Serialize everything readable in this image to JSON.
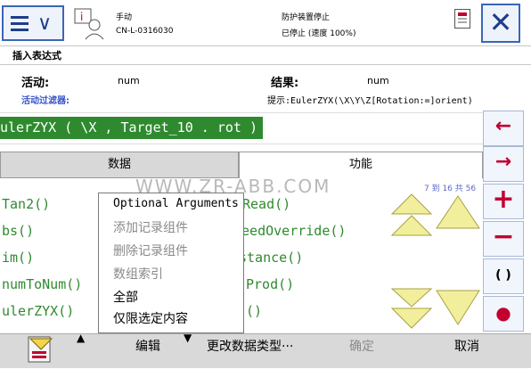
{
  "status": {
    "mode": "手动",
    "controller": "CN-L-0316030",
    "safety": "防护装置停止",
    "run_state": "已停止 (速度 100%)"
  },
  "dialog": {
    "title": "插入表达式",
    "active_label": "活动:",
    "active_value": "num",
    "result_label": "结果:",
    "result_value": "num",
    "filter_label": "活动过滤器:",
    "hint": "提示:EulerZYX(\\X\\Y\\Z[Rotation:=]orient)",
    "expression": "ulerZYX ( \\X , Target_10 . rot )"
  },
  "tabs": {
    "data": "数据",
    "functions": "功能"
  },
  "function_list": {
    "left": [
      "Tan2()",
      "bs()",
      "im()",
      "numToNum()",
      "ulerZYX()"
    ],
    "right": [
      "Read()",
      "peedOverride()",
      "stance()",
      "Prod()",
      "()"
    ],
    "count": "7 到 16 共 56"
  },
  "side_buttons": [
    "←",
    "→",
    "+",
    "−",
    "( )",
    "●"
  ],
  "edit_menu": {
    "items": [
      {
        "label": "Optional Arguments",
        "enabled": true
      },
      {
        "label": "添加记录组件",
        "enabled": false
      },
      {
        "label": "删除记录组件",
        "enabled": false
      },
      {
        "label": "数组索引",
        "enabled": false
      },
      {
        "label": "全部",
        "enabled": true
      },
      {
        "label": "仅限选定内容",
        "enabled": true
      }
    ]
  },
  "bottom": {
    "edit": "编辑",
    "change_type": "更改数据类型···",
    "ok": "确定",
    "cancel": "取消"
  },
  "watermark": "WWW.ZR-ABB.COM",
  "colors": {
    "accent_blue": "#3a66b7",
    "expression_green": "#2f8a2f",
    "side_red": "#c1002f",
    "arrow_yellow": "#f2ef9c"
  }
}
